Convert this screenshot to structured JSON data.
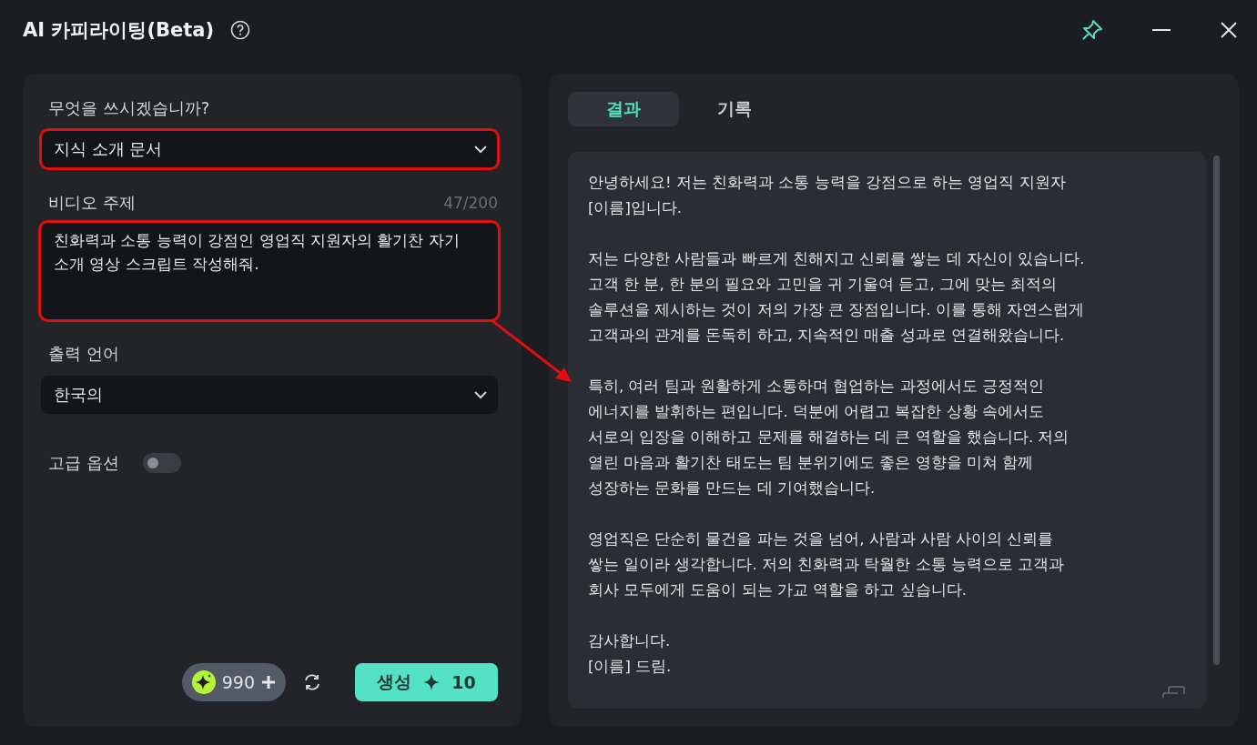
{
  "window": {
    "title": "AI 카피라이팅(Beta)"
  },
  "form": {
    "type_label": "무엇을 쓰시겠습니까?",
    "type_value": "지식 소개 문서",
    "type_highlighted": true,
    "topic_label": "비디오 주제",
    "topic_count": "47/200",
    "topic_value": "친화력과 소통 능력이 강점인 영업직 지원자의 활기찬 자기소개 영상 스크립트 작성해줘.",
    "topic_highlighted": true,
    "language_label": "출력 언어",
    "language_value": "한국의",
    "advanced_label": "고급 옵션",
    "advanced_on": false
  },
  "footer": {
    "credits": "990",
    "generate_label": "생성",
    "generate_cost": "10"
  },
  "tabs": [
    {
      "label": "결과",
      "selected": true
    },
    {
      "label": "기록",
      "selected": false
    }
  ],
  "result": {
    "paragraphs": [
      {
        "lines": [
          "안녕하세요! 저는 친화력과 소통 능력을 강점으로 하는 영업직 지원자",
          "[이름]입니다."
        ]
      },
      {
        "lines": [
          "저는 다양한 사람들과 빠르게 친해지고 신뢰를 쌓는 데 자신이 있습니다.",
          "고객 한 분, 한 분의 필요와 고민을 귀 기울여 듣고, 그에 맞는 최적의",
          "솔루션을 제시하는 것이 저의 가장 큰 장점입니다. 이를 통해 자연스럽게",
          "고객과의 관계를 돈독히 하고, 지속적인 매출 성과로 연결해왔습니다."
        ]
      },
      {
        "lines": [
          "특히, 여러 팀과 원활하게 소통하며 협업하는 과정에서도 긍정적인",
          "에너지를 발휘하는 편입니다. 덕분에 어렵고 복잡한 상황 속에서도",
          "서로의 입장을 이해하고 문제를 해결하는 데 큰 역할을 했습니다. 저의",
          "열린 마음과 활기찬 태도는 팀 분위기에도 좋은 영향을 미쳐 함께",
          "성장하는 문화를 만드는 데 기여했습니다."
        ]
      },
      {
        "lines": [
          "영업직은 단순히 물건을 파는 것을 넘어, 사람과 사람 사이의 신뢰를",
          "쌓는 일이라 생각합니다. 저의 친화력과 탁월한 소통 능력으로 고객과",
          "회사 모두에게 도움이 되는 가교 역할을 하고 싶습니다."
        ]
      },
      {
        "lines": [
          "감사합니다.",
          "[이름] 드림."
        ]
      }
    ]
  }
}
